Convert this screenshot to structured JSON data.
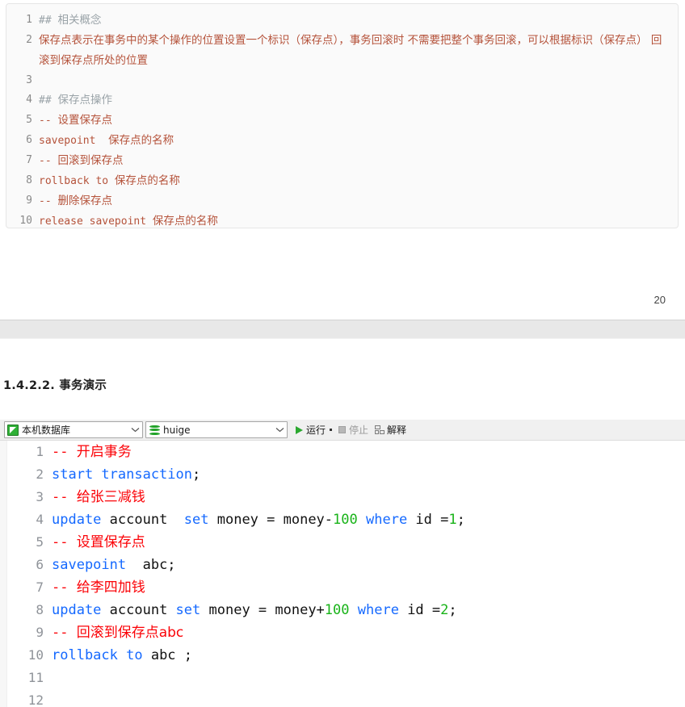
{
  "markdown_block": {
    "lines": [
      {
        "num": "1",
        "indent": 0,
        "segments": [
          {
            "text": "## ",
            "style": "comment"
          },
          {
            "text": "相关概念",
            "style": "comment-cn"
          }
        ]
      },
      {
        "num": "2",
        "indent": 1,
        "segments": [
          {
            "text": "保存点表示在事务中的某个操作的位置设置一个标识（保存点），事务回滚时 不需要把整个事务回滚，可以根据标识（保存点） 回滚到保存点所处的位置",
            "style": "cn"
          }
        ]
      },
      {
        "num": "3",
        "indent": 0,
        "segments": [
          {
            "text": "",
            "style": "plain"
          }
        ]
      },
      {
        "num": "4",
        "indent": 0,
        "segments": [
          {
            "text": "## ",
            "style": "comment"
          },
          {
            "text": "保存点操作",
            "style": "comment-cn"
          }
        ]
      },
      {
        "num": "5",
        "indent": 2,
        "segments": [
          {
            "text": "-- ",
            "style": "plain"
          },
          {
            "text": "设置保存点",
            "style": "cn"
          }
        ]
      },
      {
        "num": "6",
        "indent": 3,
        "segments": [
          {
            "text": "savepoint  ",
            "style": "plain"
          },
          {
            "text": "保存点的名称",
            "style": "cn"
          }
        ]
      },
      {
        "num": "7",
        "indent": 2,
        "segments": [
          {
            "text": "-- ",
            "style": "plain"
          },
          {
            "text": "回滚到保存点",
            "style": "cn"
          }
        ]
      },
      {
        "num": "8",
        "indent": 3,
        "segments": [
          {
            "text": "rollback to ",
            "style": "plain"
          },
          {
            "text": "保存点的名称",
            "style": "cn"
          }
        ]
      },
      {
        "num": "9",
        "indent": 2,
        "segments": [
          {
            "text": "-- ",
            "style": "plain"
          },
          {
            "text": "删除保存点",
            "style": "cn"
          }
        ]
      },
      {
        "num": "10",
        "indent": 3,
        "segments": [
          {
            "text": "release savepoint ",
            "style": "plain"
          },
          {
            "text": "保存点的名称",
            "style": "cn"
          }
        ]
      }
    ]
  },
  "page_number": "20",
  "section": {
    "heading": "1.4.2.2. 事务演示"
  },
  "toolbar": {
    "connection": {
      "icon": "connection-icon",
      "value": "本机数据库"
    },
    "schema": {
      "icon": "database-icon",
      "value": "huige"
    },
    "run_label": "运行",
    "stop_label": "停止",
    "explain_label": "解释"
  },
  "editor": {
    "lines": [
      {
        "num": "1",
        "segments": [
          {
            "text": "-- ",
            "style": "cm"
          },
          {
            "text": "开启事务",
            "style": "cmcn"
          }
        ]
      },
      {
        "num": "2",
        "segments": [
          {
            "text": "start transaction",
            "style": "kw"
          },
          {
            "text": ";",
            "style": "plain"
          }
        ]
      },
      {
        "num": "3",
        "segments": [
          {
            "text": "-- ",
            "style": "cm"
          },
          {
            "text": "给张三减钱",
            "style": "cmcn"
          }
        ]
      },
      {
        "num": "4",
        "segments": [
          {
            "text": "update",
            "style": "kw"
          },
          {
            "text": " account  ",
            "style": "plain"
          },
          {
            "text": "set",
            "style": "kw"
          },
          {
            "text": " money = money-",
            "style": "plain"
          },
          {
            "text": "100",
            "style": "num"
          },
          {
            "text": " ",
            "style": "plain"
          },
          {
            "text": "where",
            "style": "kw"
          },
          {
            "text": " id =",
            "style": "plain"
          },
          {
            "text": "1",
            "style": "num"
          },
          {
            "text": ";",
            "style": "plain"
          }
        ]
      },
      {
        "num": "5",
        "segments": [
          {
            "text": "-- ",
            "style": "cm"
          },
          {
            "text": "设置保存点",
            "style": "cmcn"
          }
        ]
      },
      {
        "num": "6",
        "segments": [
          {
            "text": "savepoint",
            "style": "kw"
          },
          {
            "text": "  abc;",
            "style": "plain"
          }
        ]
      },
      {
        "num": "7",
        "segments": [
          {
            "text": "-- ",
            "style": "cm"
          },
          {
            "text": "给李四加钱",
            "style": "cmcn"
          }
        ]
      },
      {
        "num": "8",
        "segments": [
          {
            "text": "update",
            "style": "kw"
          },
          {
            "text": " account ",
            "style": "plain"
          },
          {
            "text": "set",
            "style": "kw"
          },
          {
            "text": " money = money+",
            "style": "plain"
          },
          {
            "text": "100",
            "style": "num"
          },
          {
            "text": " ",
            "style": "plain"
          },
          {
            "text": "where",
            "style": "kw"
          },
          {
            "text": " id =",
            "style": "plain"
          },
          {
            "text": "2",
            "style": "num"
          },
          {
            "text": ";",
            "style": "plain"
          }
        ]
      },
      {
        "num": "9",
        "segments": [
          {
            "text": "-- ",
            "style": "cm"
          },
          {
            "text": "回滚到保存点abc",
            "style": "cmcn"
          }
        ]
      },
      {
        "num": "10",
        "segments": [
          {
            "text": "rollback to",
            "style": "kw"
          },
          {
            "text": " abc ;",
            "style": "plain"
          }
        ]
      },
      {
        "num": "11",
        "segments": []
      },
      {
        "num": "12",
        "segments": []
      }
    ]
  },
  "colors": {
    "comment": "#fb0207",
    "keyword": "#1569ff",
    "number": "#18b318",
    "markdown_text": "#b5533b",
    "markdown_heading": "#9aa3a8",
    "accent_green": "#2aa82f"
  }
}
